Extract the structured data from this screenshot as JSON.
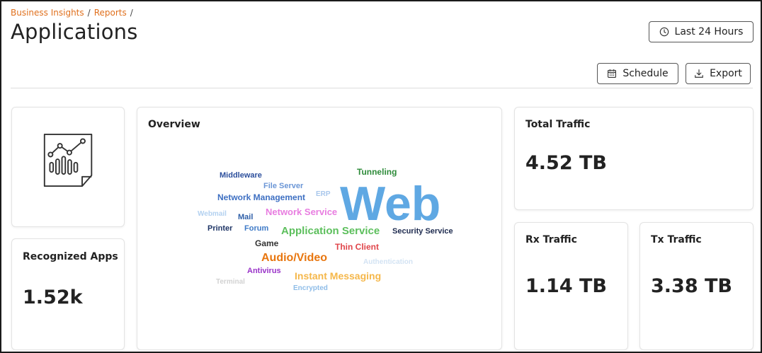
{
  "breadcrumb": [
    {
      "label": "Business Insights"
    },
    {
      "label": "Reports"
    }
  ],
  "breadcrumb_separator": "/",
  "page_title": "Applications",
  "time_range_button": {
    "label": "Last 24 Hours",
    "icon": "clock-icon"
  },
  "schedule_button": {
    "label": "Schedule",
    "icon": "calendar-icon"
  },
  "export_button": {
    "label": "Export",
    "icon": "download-icon"
  },
  "report_icon_card": {
    "icon": "report-chart-icon"
  },
  "recognized_apps": {
    "title": "Recognized Apps",
    "value": "1.52k"
  },
  "overview": {
    "title": "Overview",
    "words": [
      {
        "text": "Web",
        "color": "#5fa8e3"
      },
      {
        "text": "Tunneling",
        "color": "#2e8b3a"
      },
      {
        "text": "Middleware",
        "color": "#2c4f9c"
      },
      {
        "text": "File Server",
        "color": "#6b96d6"
      },
      {
        "text": "ERP",
        "color": "#a9c7ec"
      },
      {
        "text": "Network Management",
        "color": "#3d6fc2"
      },
      {
        "text": "Webmail",
        "color": "#b3d1f0"
      },
      {
        "text": "Mail",
        "color": "#2f5fa8"
      },
      {
        "text": "Network Service",
        "color": "#e87de0"
      },
      {
        "text": "Printer",
        "color": "#1f3566"
      },
      {
        "text": "Forum",
        "color": "#3e7ac7"
      },
      {
        "text": "Application Service",
        "color": "#5cbf5c"
      },
      {
        "text": "Security Service",
        "color": "#1e2b4f"
      },
      {
        "text": "Game",
        "color": "#333333"
      },
      {
        "text": "Thin Client",
        "color": "#e0454a"
      },
      {
        "text": "Audio/Video",
        "color": "#e8760f"
      },
      {
        "text": "Authentication",
        "color": "#d3e3f3"
      },
      {
        "text": "Antivirus",
        "color": "#9932c8"
      },
      {
        "text": "Instant Messaging",
        "color": "#f5b74a"
      },
      {
        "text": "Terminal",
        "color": "#d2d2d2"
      },
      {
        "text": "Encrypted",
        "color": "#8fbde8"
      }
    ]
  },
  "total_traffic": {
    "title": "Total Traffic",
    "value": "4.52 TB"
  },
  "rx_traffic": {
    "title": "Rx Traffic",
    "value": "1.14 TB"
  },
  "tx_traffic": {
    "title": "Tx Traffic",
    "value": "3.38 TB"
  }
}
